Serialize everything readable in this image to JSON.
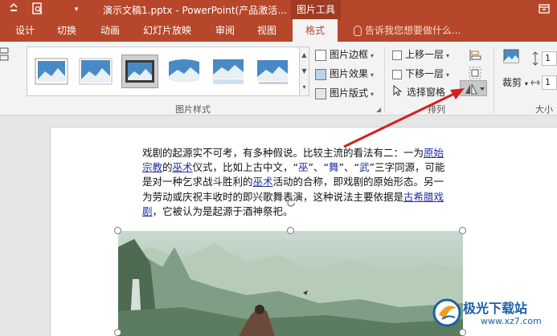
{
  "titlebar": {
    "title": "演示文稿1.pptx - PowerPoint(产品激活...",
    "context_tab": "图片工具"
  },
  "tabs": [
    "设计",
    "切换",
    "动画",
    "幻灯片放映",
    "审阅",
    "视图",
    "格式"
  ],
  "tell_me": "告诉我您想要做什么...",
  "ribbon": {
    "picture_styles_label": "图片样式",
    "picture_border": "图片边框",
    "picture_effects": "图片效果",
    "picture_layout": "图片版式",
    "bring_forward": "上移一层",
    "send_backward": "下移一层",
    "selection_pane": "选择窗格",
    "arrange_label": "排列",
    "crop": "裁剪",
    "size_label": "大小",
    "size_value_1": "1",
    "size_value_2": "1"
  },
  "document": {
    "p1": "戏剧的起源实不可考，有多种假说。比较主流的看法有二：一为",
    "link1": "原始宗教",
    "p2": "的",
    "link2": "巫术",
    "p3": "仪式，比如上古中文，“",
    "q1": "巫",
    "p4": "”、“",
    "q2": "舞",
    "p5": "”、“",
    "q3": "武",
    "p6": "”三字同源，可能是对一种乞求战斗胜利的",
    "link3": "巫术",
    "p7": "活动的合称，即戏剧的原始形态。另一为劳动或庆祝丰收时的即兴歌舞表演，这种说法主要依据是",
    "link4": "古希腊戏剧",
    "p8": "，它被认为是起源于酒神祭祀。"
  },
  "watermark": {
    "text": "极光下载站",
    "url": "www.xz7.com"
  },
  "colors": {
    "brand": "#b7472a",
    "link": "#1f2fa0",
    "arrow": "#d32020"
  }
}
